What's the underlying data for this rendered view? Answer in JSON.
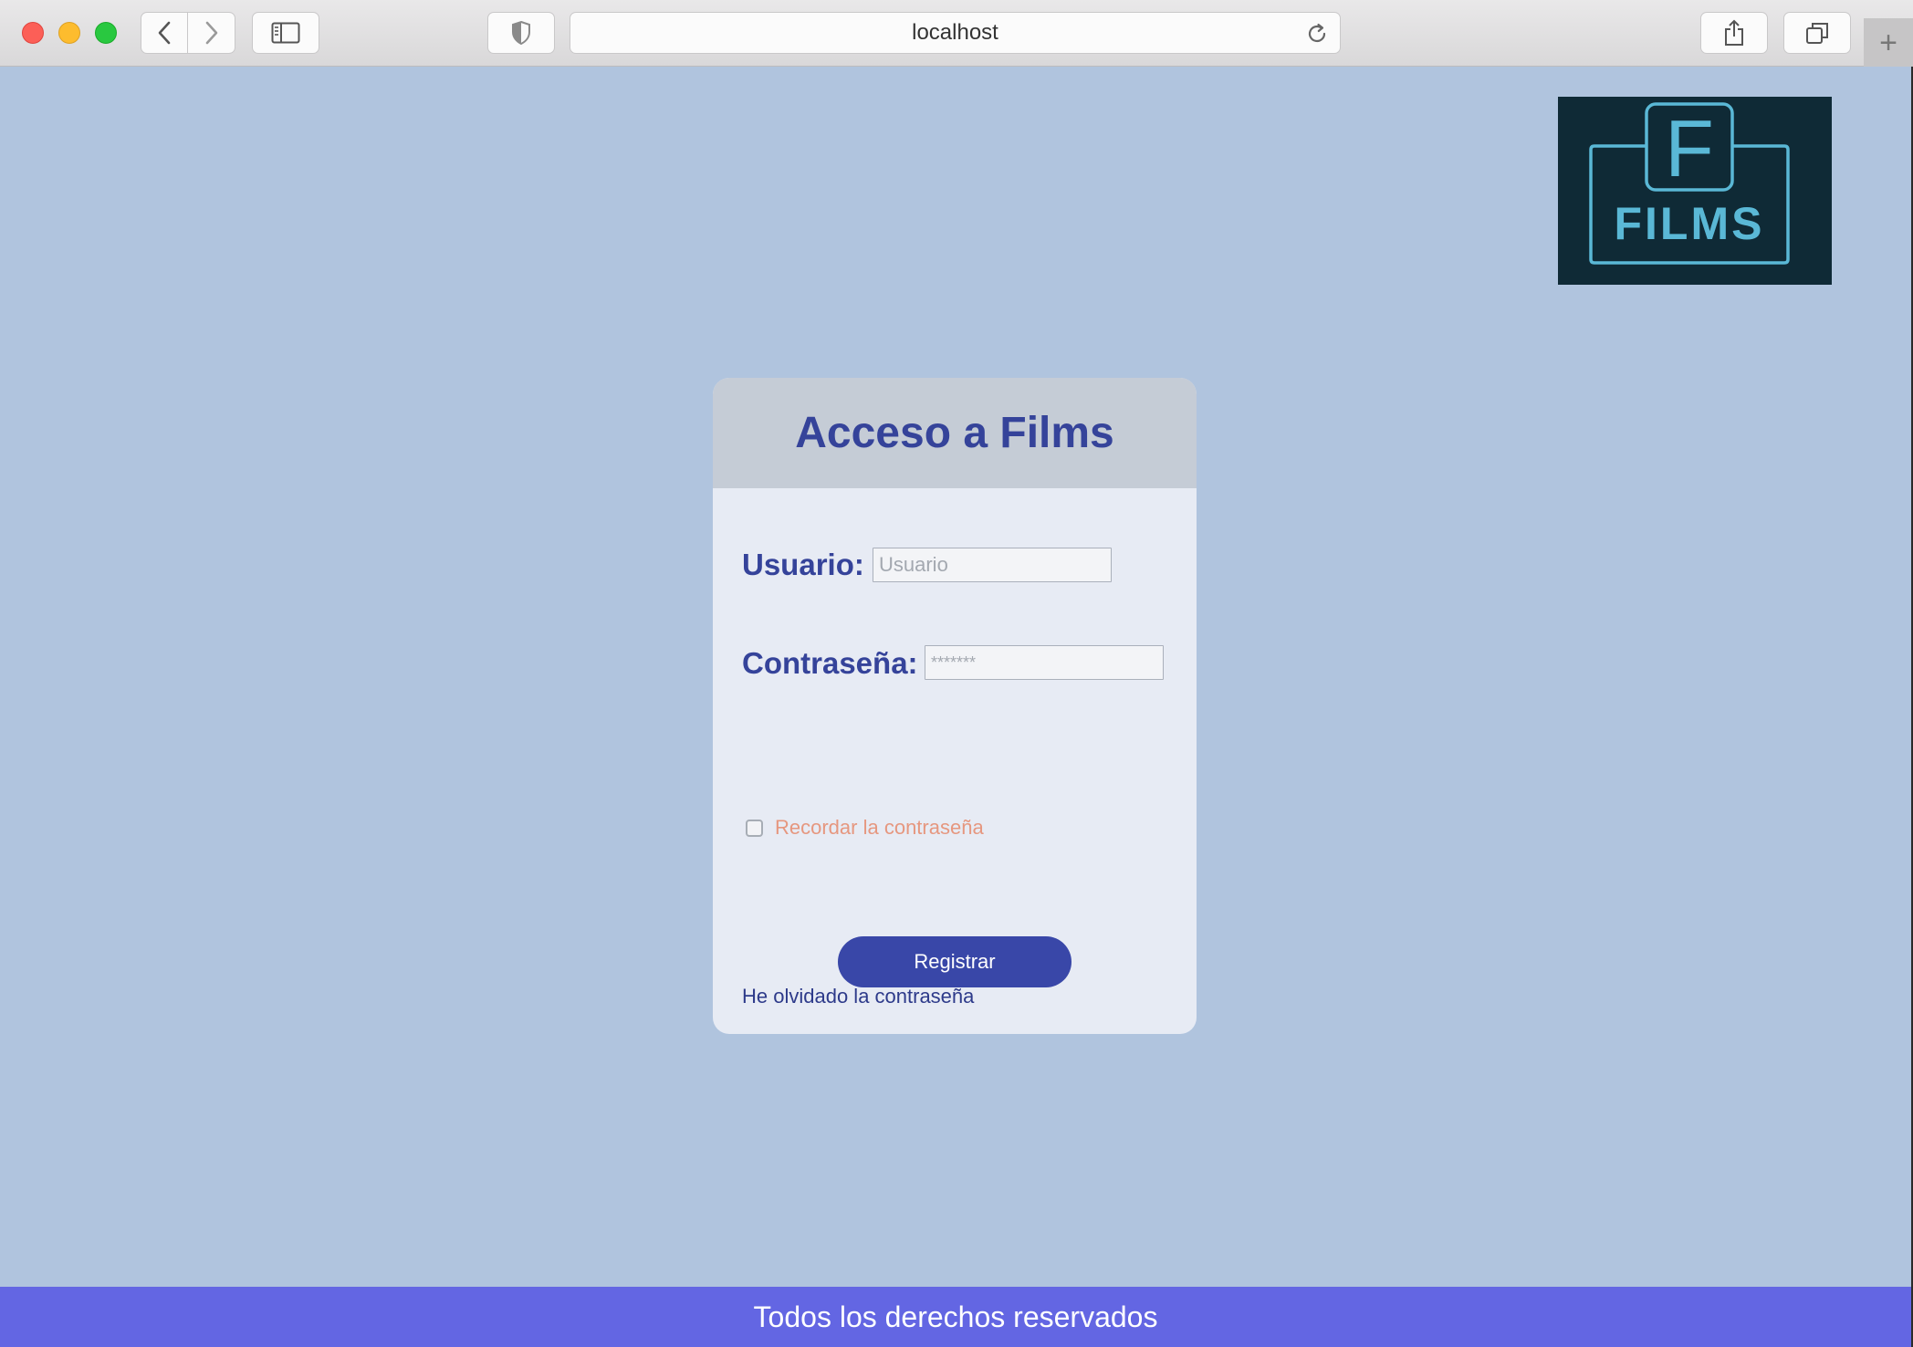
{
  "browser": {
    "url": "localhost",
    "new_tab_glyph": "+",
    "icons": [
      "back-arrow-icon",
      "forward-arrow-icon",
      "sidebar-icon",
      "shield-icon",
      "reload-icon",
      "share-icon",
      "tabs-overview-icon",
      "new-tab-icon"
    ]
  },
  "logo": {
    "letter": "F",
    "wordmark": "FILMS",
    "colors": {
      "background": "#0f2a36",
      "stroke": "#5ab8d6"
    }
  },
  "login": {
    "title": "Acceso a Films",
    "username_label": "Usuario:",
    "username_placeholder": "Usuario",
    "username_value": "",
    "password_label": "Contraseña:",
    "password_placeholder": "*******",
    "password_value": "",
    "remember_label": "Recordar la contraseña",
    "remember_checked": false,
    "submit_label": "Registrar",
    "forgot_label": "He olvidado la contraseña"
  },
  "footer": {
    "text": "Todos los derechos reservados"
  },
  "colors": {
    "page_background": "#b0c4de",
    "card_background": "#e7ebf4",
    "card_header": "#c5ccd6",
    "title": "#35439a",
    "button": "#3947a8",
    "remember_text": "#e6977f",
    "footer": "#6366e3"
  }
}
